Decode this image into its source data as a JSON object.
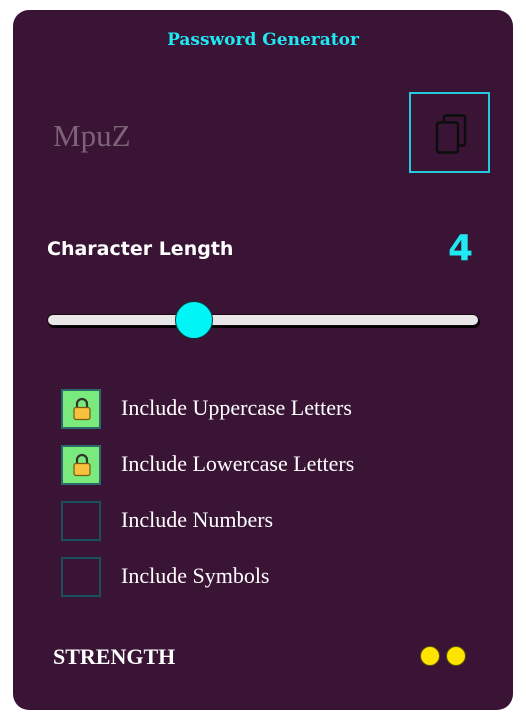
{
  "app": {
    "title": "Password Generator"
  },
  "password": {
    "value": "MpuZ"
  },
  "copy_button": {
    "icon": "copy-icon"
  },
  "length": {
    "label": "Character Length",
    "value": "4",
    "slider_fraction": 0.325
  },
  "options": [
    {
      "label": "Include Uppercase Letters",
      "checked": true,
      "icon": "lock-icon"
    },
    {
      "label": "Include Lowercase Letters",
      "checked": true,
      "icon": "lock-icon"
    },
    {
      "label": "Include Numbers",
      "checked": false
    },
    {
      "label": "Include Symbols",
      "checked": false
    }
  ],
  "strength": {
    "label": "STRENGTH",
    "level": 2,
    "color": "#ffe400"
  },
  "colors": {
    "background": "#3a1434",
    "accent": "#1fe9f3",
    "checked": "#7bea7d"
  }
}
